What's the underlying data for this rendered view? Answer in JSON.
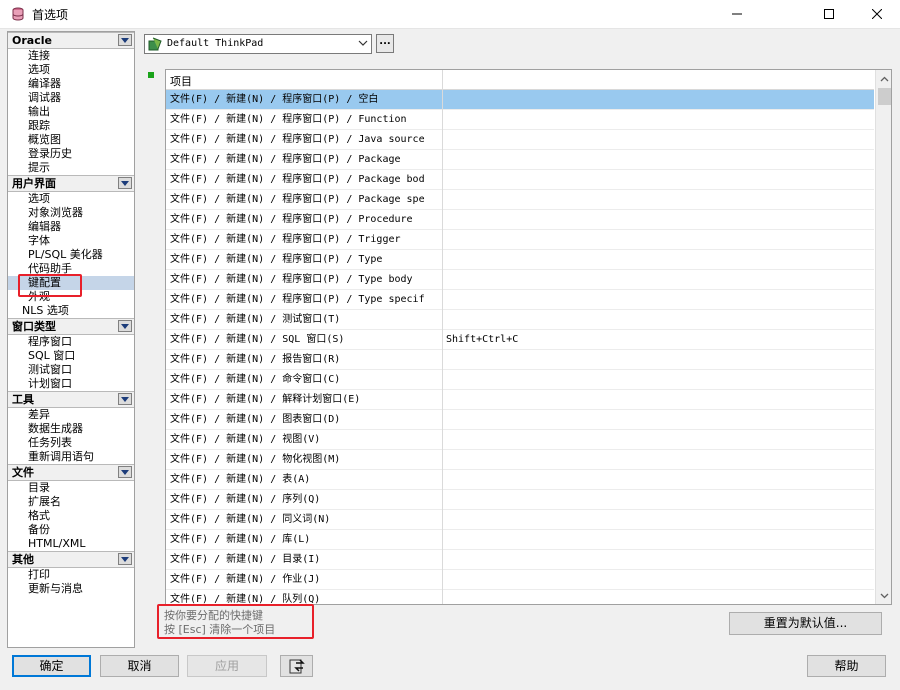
{
  "window": {
    "title": "首选项"
  },
  "sidebar": {
    "groups": [
      {
        "header": "Oracle",
        "items": [
          "连接",
          "选项",
          "编译器",
          "调试器",
          "输出",
          "跟踪",
          "概览图",
          "登录历史",
          "提示"
        ]
      },
      {
        "header": "用户界面",
        "items": [
          "选项",
          "对象浏览器",
          "编辑器",
          "字体",
          "PL/SQL 美化器",
          "代码助手",
          "键配置",
          "外观",
          "NLS 选项"
        ],
        "selected": "键配置"
      },
      {
        "header": "窗口类型",
        "items": [
          "程序窗口",
          "SQL 窗口",
          "测试窗口",
          "计划窗口"
        ]
      },
      {
        "header": "工具",
        "items": [
          "差异",
          "数据生成器",
          "任务列表",
          "重新调用语句"
        ]
      },
      {
        "header": "文件",
        "items": [
          "目录",
          "扩展名",
          "格式",
          "备份",
          "HTML/XML"
        ]
      },
      {
        "header": "其他",
        "items": [
          "打印",
          "更新与消息"
        ]
      }
    ]
  },
  "profile": {
    "selected": "Default ThinkPad",
    "more_label": "..."
  },
  "grid": {
    "column_header": "项目",
    "rows": [
      {
        "item": "文件(F) / 新建(N) / 程序窗口(P) / 空白",
        "key": ""
      },
      {
        "item": "文件(F) / 新建(N) / 程序窗口(P) / Function",
        "key": ""
      },
      {
        "item": "文件(F) / 新建(N) / 程序窗口(P) / Java source",
        "key": ""
      },
      {
        "item": "文件(F) / 新建(N) / 程序窗口(P) / Package",
        "key": ""
      },
      {
        "item": "文件(F) / 新建(N) / 程序窗口(P) / Package bod",
        "key": ""
      },
      {
        "item": "文件(F) / 新建(N) / 程序窗口(P) / Package spe",
        "key": ""
      },
      {
        "item": "文件(F) / 新建(N) / 程序窗口(P) / Procedure",
        "key": ""
      },
      {
        "item": "文件(F) / 新建(N) / 程序窗口(P) / Trigger",
        "key": ""
      },
      {
        "item": "文件(F) / 新建(N) / 程序窗口(P) / Type",
        "key": ""
      },
      {
        "item": "文件(F) / 新建(N) / 程序窗口(P) / Type body",
        "key": ""
      },
      {
        "item": "文件(F) / 新建(N) / 程序窗口(P) / Type specif",
        "key": ""
      },
      {
        "item": "文件(F) / 新建(N) / 测试窗口(T)",
        "key": ""
      },
      {
        "item": "文件(F) / 新建(N) / SQL 窗口(S)",
        "key": "Shift+Ctrl+C"
      },
      {
        "item": "文件(F) / 新建(N) / 报告窗口(R)",
        "key": ""
      },
      {
        "item": "文件(F) / 新建(N) / 命令窗口(C)",
        "key": ""
      },
      {
        "item": "文件(F) / 新建(N) / 解释计划窗口(E)",
        "key": ""
      },
      {
        "item": "文件(F) / 新建(N) / 图表窗口(D)",
        "key": ""
      },
      {
        "item": "文件(F) / 新建(N) / 视图(V)",
        "key": ""
      },
      {
        "item": "文件(F) / 新建(N) / 物化视图(M)",
        "key": ""
      },
      {
        "item": "文件(F) / 新建(N) / 表(A)",
        "key": ""
      },
      {
        "item": "文件(F) / 新建(N) / 序列(Q)",
        "key": ""
      },
      {
        "item": "文件(F) / 新建(N) / 同义词(N)",
        "key": ""
      },
      {
        "item": "文件(F) / 新建(N) / 库(L)",
        "key": ""
      },
      {
        "item": "文件(F) / 新建(N) / 目录(I)",
        "key": ""
      },
      {
        "item": "文件(F) / 新建(N) / 作业(J)",
        "key": ""
      },
      {
        "item": "文件(F) / 新建(N) / 队列(Q)",
        "key": ""
      }
    ]
  },
  "hint": {
    "line1": "按你要分配的快捷键",
    "line2": "按 [Esc] 清除一个项目"
  },
  "buttons": {
    "reset": "重置为默认值...",
    "ok": "确定",
    "cancel": "取消",
    "apply": "应用",
    "help": "帮助"
  },
  "colors": {
    "selection": "#99c9ef",
    "sidebar_selection": "#c5d5e8",
    "highlight_box": "#e8202a",
    "default_button_border": "#0078d7"
  }
}
